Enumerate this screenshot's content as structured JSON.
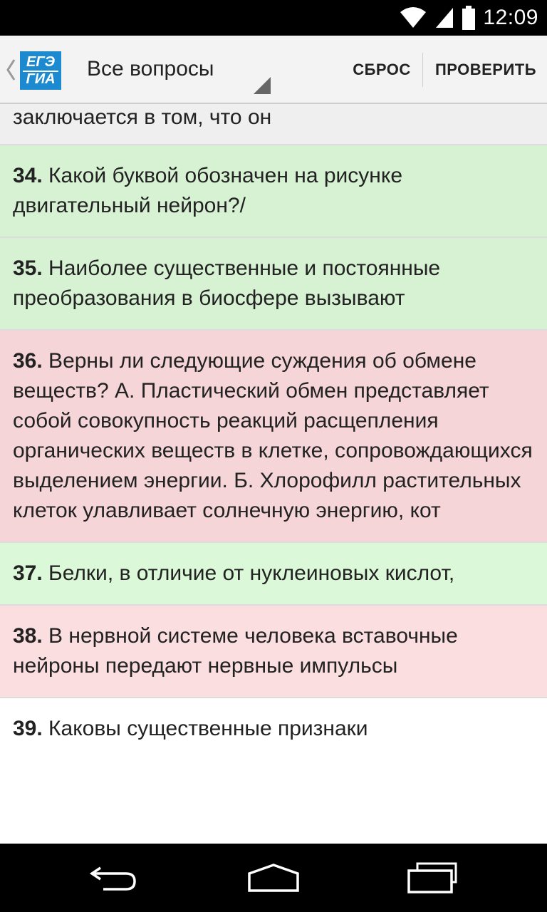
{
  "status_bar": {
    "time": "12:09",
    "icons": [
      "wifi-icon",
      "signal-icon",
      "battery-icon"
    ]
  },
  "action_bar": {
    "logo_top": "ЕГЭ",
    "logo_bottom": "ГИА",
    "spinner_label": "Все вопросы",
    "reset_label": "СБРОС",
    "check_label": "ПРОВЕРИТЬ"
  },
  "questions": [
    {
      "number": "",
      "text": "заключается в том, что он"
    },
    {
      "number": "34.",
      "text": " Какой буквой обозначен на рисунке двигательный нейрон?/"
    },
    {
      "number": "35.",
      "text": " Наиболее существенные и постоянные преобразования в биосфере вызывают"
    },
    {
      "number": "36.",
      "text": " Верны ли следующие суждения об обмене веществ? А. Пластический обмен представляет собой совокупность реакций расщепления органических веществ в клетке, сопровождающихся выделением энергии. Б. Хлорофилл растительных клеток улавливает солнечную энергию, кот"
    },
    {
      "number": "37.",
      "text": " Белки, в отличие от нуклеиновых кислот,"
    },
    {
      "number": "38.",
      "text": " В нервной системе человека вставочные нейроны передают нервные импульсы"
    },
    {
      "number": "39.",
      "text": " Каковы существенные признаки"
    }
  ],
  "colors": {
    "correct": "#d6f2d3",
    "incorrect": "#f5d5d7",
    "logo": "#1b8ad0"
  },
  "nav_bar": {
    "icons": [
      "back-icon",
      "home-icon",
      "recents-icon"
    ]
  }
}
